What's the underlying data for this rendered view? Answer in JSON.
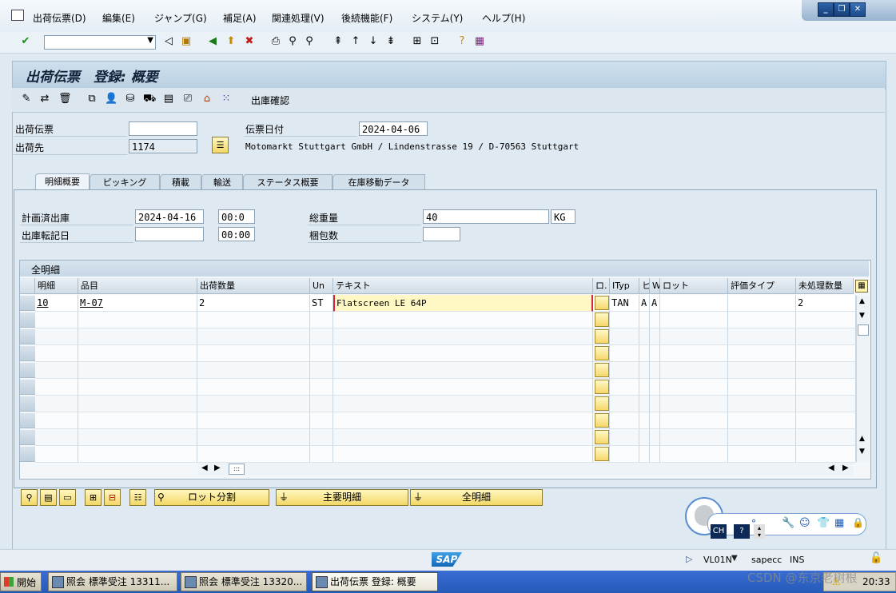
{
  "menu": {
    "items": [
      "出荷伝票(D)",
      "編集(E)",
      "ジャンプ(G)",
      "補足(A)",
      "関連処理(V)",
      "後続機能(F)",
      "システム(Y)",
      "ヘルプ(H)"
    ]
  },
  "window_controls": {
    "minimize": "_",
    "restore": "❐",
    "close": "✕"
  },
  "screen": {
    "title": "出荷伝票　登録: 概要"
  },
  "app_toolbar": {
    "confirm_label": "出庫確認"
  },
  "header": {
    "delivery_label": "出荷伝票",
    "delivery_value": "",
    "shipto_label": "出荷先",
    "shipto_value": "1174",
    "date_label": "伝票日付",
    "date_value": "2024-04-06",
    "address": "Motomarkt Stuttgart GmbH / Lindenstrasse 19 / D-70563 Stuttgart"
  },
  "tabs": [
    "明細概要",
    "ピッキング",
    "積載",
    "輸送",
    "ステータス概要",
    "在庫移動データ"
  ],
  "overview": {
    "planned_gi_label": "計画済出庫",
    "planned_gi_date": "2024-04-16",
    "planned_gi_time": "00:0",
    "actual_gi_label": "出庫転記日",
    "actual_gi_date": "",
    "actual_gi_time": "00:00",
    "gross_weight_label": "総重量",
    "gross_weight_value": "40",
    "gross_weight_unit": "KG",
    "packages_label": "梱包数",
    "packages_value": ""
  },
  "table": {
    "title": "全明細",
    "headers": [
      "明細",
      "品目",
      "出荷数量",
      "Un",
      "テキスト",
      "ロ.",
      "ITyp",
      "ヒ",
      "W.",
      "ロット",
      "評価タイプ",
      "未処理数量"
    ],
    "rows": [
      {
        "item": "10",
        "material": "M-07",
        "qty": "2",
        "unit": "ST",
        "text": "Flatscreen LE 64P",
        "ityp": "TAN",
        "h": "A",
        "w": "A",
        "open": "2"
      }
    ]
  },
  "buttons": {
    "batch_split": "ロット分割",
    "main_items": "主要明細",
    "all_items": "全明細"
  },
  "status": {
    "tcode": "VL01N",
    "server": "sapecc",
    "mode": "INS"
  },
  "taskbar": {
    "start": "開始",
    "tasks": [
      "照会 標準受注 13311...",
      "照会 標準受注 13320...",
      "出荷伝票 登録: 概要"
    ],
    "clock": "20:33"
  },
  "ime": {
    "lang": "CH",
    "help": "?"
  },
  "watermark": "CSDN @东京老树根"
}
